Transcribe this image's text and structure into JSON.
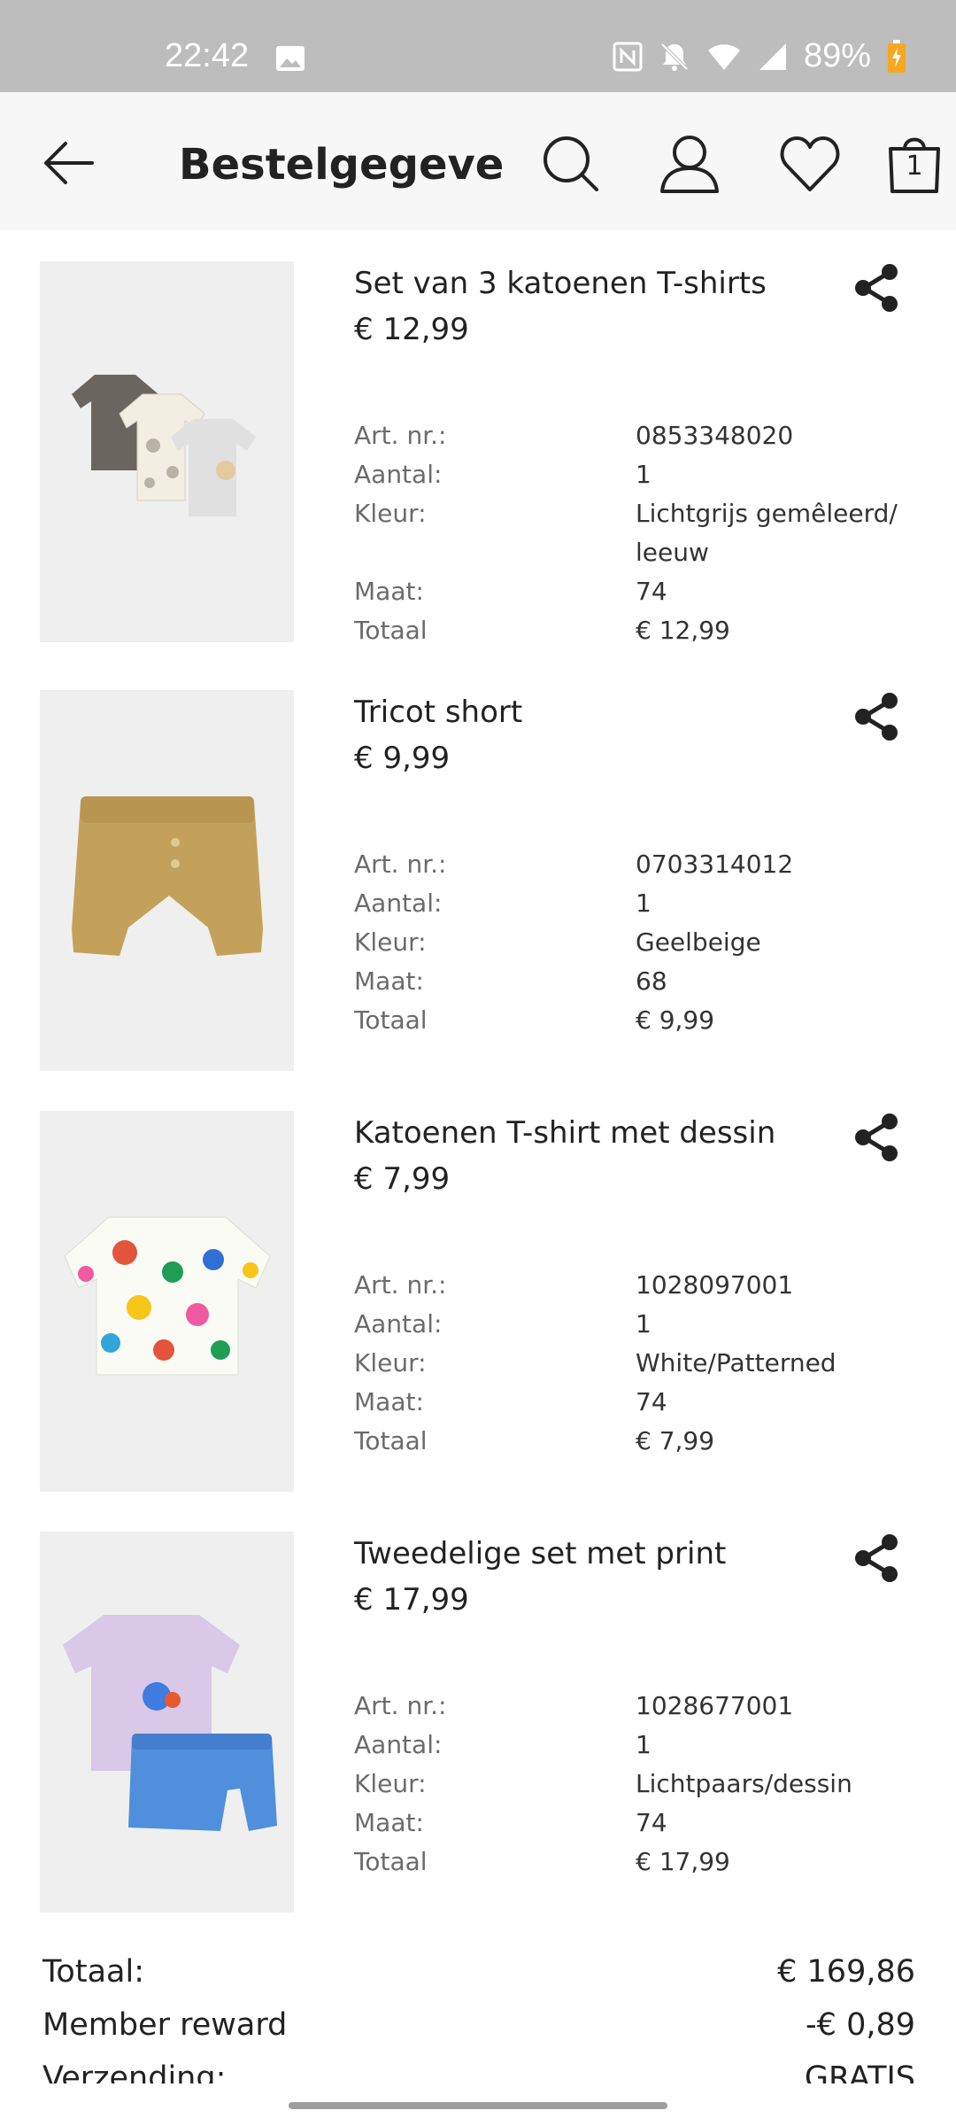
{
  "status_bar": {
    "time": "22:42",
    "battery": "89%"
  },
  "header": {
    "title": "Bestelgegeve...",
    "cart_count": "1"
  },
  "labels": {
    "art": "Art. nr.:",
    "qty": "Aantal:",
    "color": "Kleur:",
    "size": "Maat:",
    "total": "Totaal"
  },
  "items": [
    {
      "name": "Set van 3 katoenen T-shirts",
      "price": "€ 12,99",
      "art": "0853348020",
      "qty": "1",
      "color": "Lichtgrijs gemêleerd/ leeuw",
      "size": "74",
      "total": "€ 12,99"
    },
    {
      "name": "Tricot short",
      "price": "€ 9,99",
      "art": "0703314012",
      "qty": "1",
      "color": "Geelbeige",
      "size": "68",
      "total": "€ 9,99"
    },
    {
      "name": "Katoenen T-shirt met dessin",
      "price": "€ 7,99",
      "art": "1028097001",
      "qty": "1",
      "color": "White/Patterned",
      "size": "74",
      "total": "€ 7,99"
    },
    {
      "name": "Tweedelige set met print",
      "price": "€ 17,99",
      "art": "1028677001",
      "qty": "1",
      "color": "Lichtpaars/dessin",
      "size": "74",
      "total": "€ 17,99"
    }
  ],
  "summary": {
    "total_label": "Totaal:",
    "total_value": "€ 169,86",
    "reward_label": "Member reward",
    "reward_value": "-€ 0,89",
    "shipping_label": "Verzending:",
    "shipping_value": "GRATIS"
  },
  "colors": {
    "statusbar": "#bdbdbd",
    "topbar": "#f7f7f7",
    "text": "#222222",
    "muted": "#6b6b6b"
  }
}
